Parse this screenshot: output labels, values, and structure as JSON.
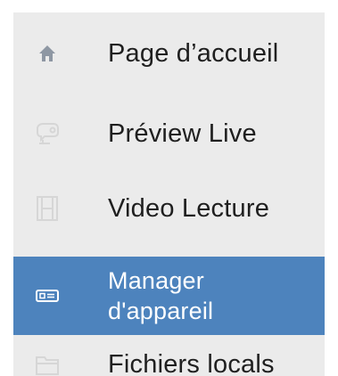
{
  "menu": {
    "items": [
      {
        "label": "Page d’accueil",
        "icon": "home-icon",
        "selected": false
      },
      {
        "label": "Préview Live",
        "icon": "camera-icon",
        "selected": false
      },
      {
        "label": "Video Lecture",
        "icon": "film-icon",
        "selected": false
      },
      {
        "label": "Manager\nd'appareil",
        "icon": "dvr-device-icon",
        "selected": true
      },
      {
        "label": "Fichiers locals",
        "icon": "folder-icon",
        "selected": false
      }
    ]
  },
  "colors": {
    "menu_background": "#ebebeb",
    "selected_background": "#4d83bd",
    "text": "#1f1f1f",
    "selected_text": "#ffffff",
    "home_icon": "#8e97a3",
    "inactive_icon": "#d6d6d6"
  }
}
